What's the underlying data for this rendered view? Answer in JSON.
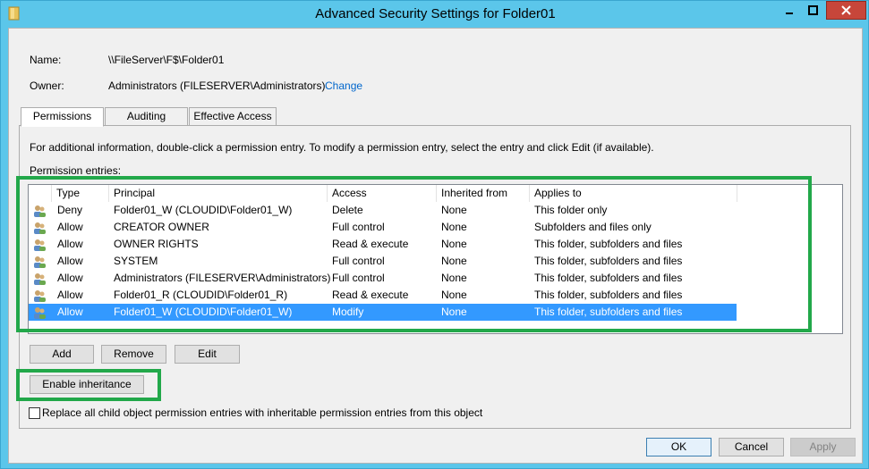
{
  "window": {
    "title": "Advanced Security Settings for Folder01",
    "controls": {
      "minimize": "—",
      "maximize": "□",
      "close": "✕"
    }
  },
  "name": {
    "label": "Name:",
    "value": "\\\\FileServer\\F$\\Folder01"
  },
  "owner": {
    "label": "Owner:",
    "value": "Administrators (FILESERVER\\Administrators)",
    "change_link": "Change"
  },
  "tabs": [
    {
      "label": "Permissions",
      "active": true
    },
    {
      "label": "Auditing",
      "active": false
    },
    {
      "label": "Effective Access",
      "active": false
    }
  ],
  "info_text": "For additional information, double-click a permission entry. To modify a permission entry, select the entry and click Edit (if available).",
  "entries_label": "Permission entries:",
  "columns": [
    "Type",
    "Principal",
    "Access",
    "Inherited from",
    "Applies to"
  ],
  "entries": [
    {
      "type": "Deny",
      "principal": "Folder01_W (CLOUDID\\Folder01_W)",
      "access": "Delete",
      "inherited": "None",
      "applies": "This folder only"
    },
    {
      "type": "Allow",
      "principal": "CREATOR OWNER",
      "access": "Full control",
      "inherited": "None",
      "applies": "Subfolders and files only"
    },
    {
      "type": "Allow",
      "principal": "OWNER RIGHTS",
      "access": "Read & execute",
      "inherited": "None",
      "applies": "This folder, subfolders and files"
    },
    {
      "type": "Allow",
      "principal": "SYSTEM",
      "access": "Full control",
      "inherited": "None",
      "applies": "This folder, subfolders and files"
    },
    {
      "type": "Allow",
      "principal": "Administrators (FILESERVER\\Administrators)",
      "access": "Full control",
      "inherited": "None",
      "applies": "This folder, subfolders and files"
    },
    {
      "type": "Allow",
      "principal": "Folder01_R (CLOUDID\\Folder01_R)",
      "access": "Read & execute",
      "inherited": "None",
      "applies": "This folder, subfolders and files"
    },
    {
      "type": "Allow",
      "principal": "Folder01_W (CLOUDID\\Folder01_W)",
      "access": "Modify",
      "inherited": "None",
      "applies": "This folder, subfolders and files",
      "selected": true
    }
  ],
  "buttons": {
    "add": "Add",
    "remove": "Remove",
    "edit": "Edit",
    "enable_inheritance": "Enable inheritance",
    "ok": "OK",
    "cancel": "Cancel",
    "apply": "Apply"
  },
  "replace_checkbox": {
    "label": "Replace all child object permission entries with inheritable permission entries from this object",
    "checked": false
  },
  "colors": {
    "selection": "#3399ff",
    "highlight_box": "#22a84a",
    "link": "#0066cc",
    "close_button": "#c7463a"
  }
}
